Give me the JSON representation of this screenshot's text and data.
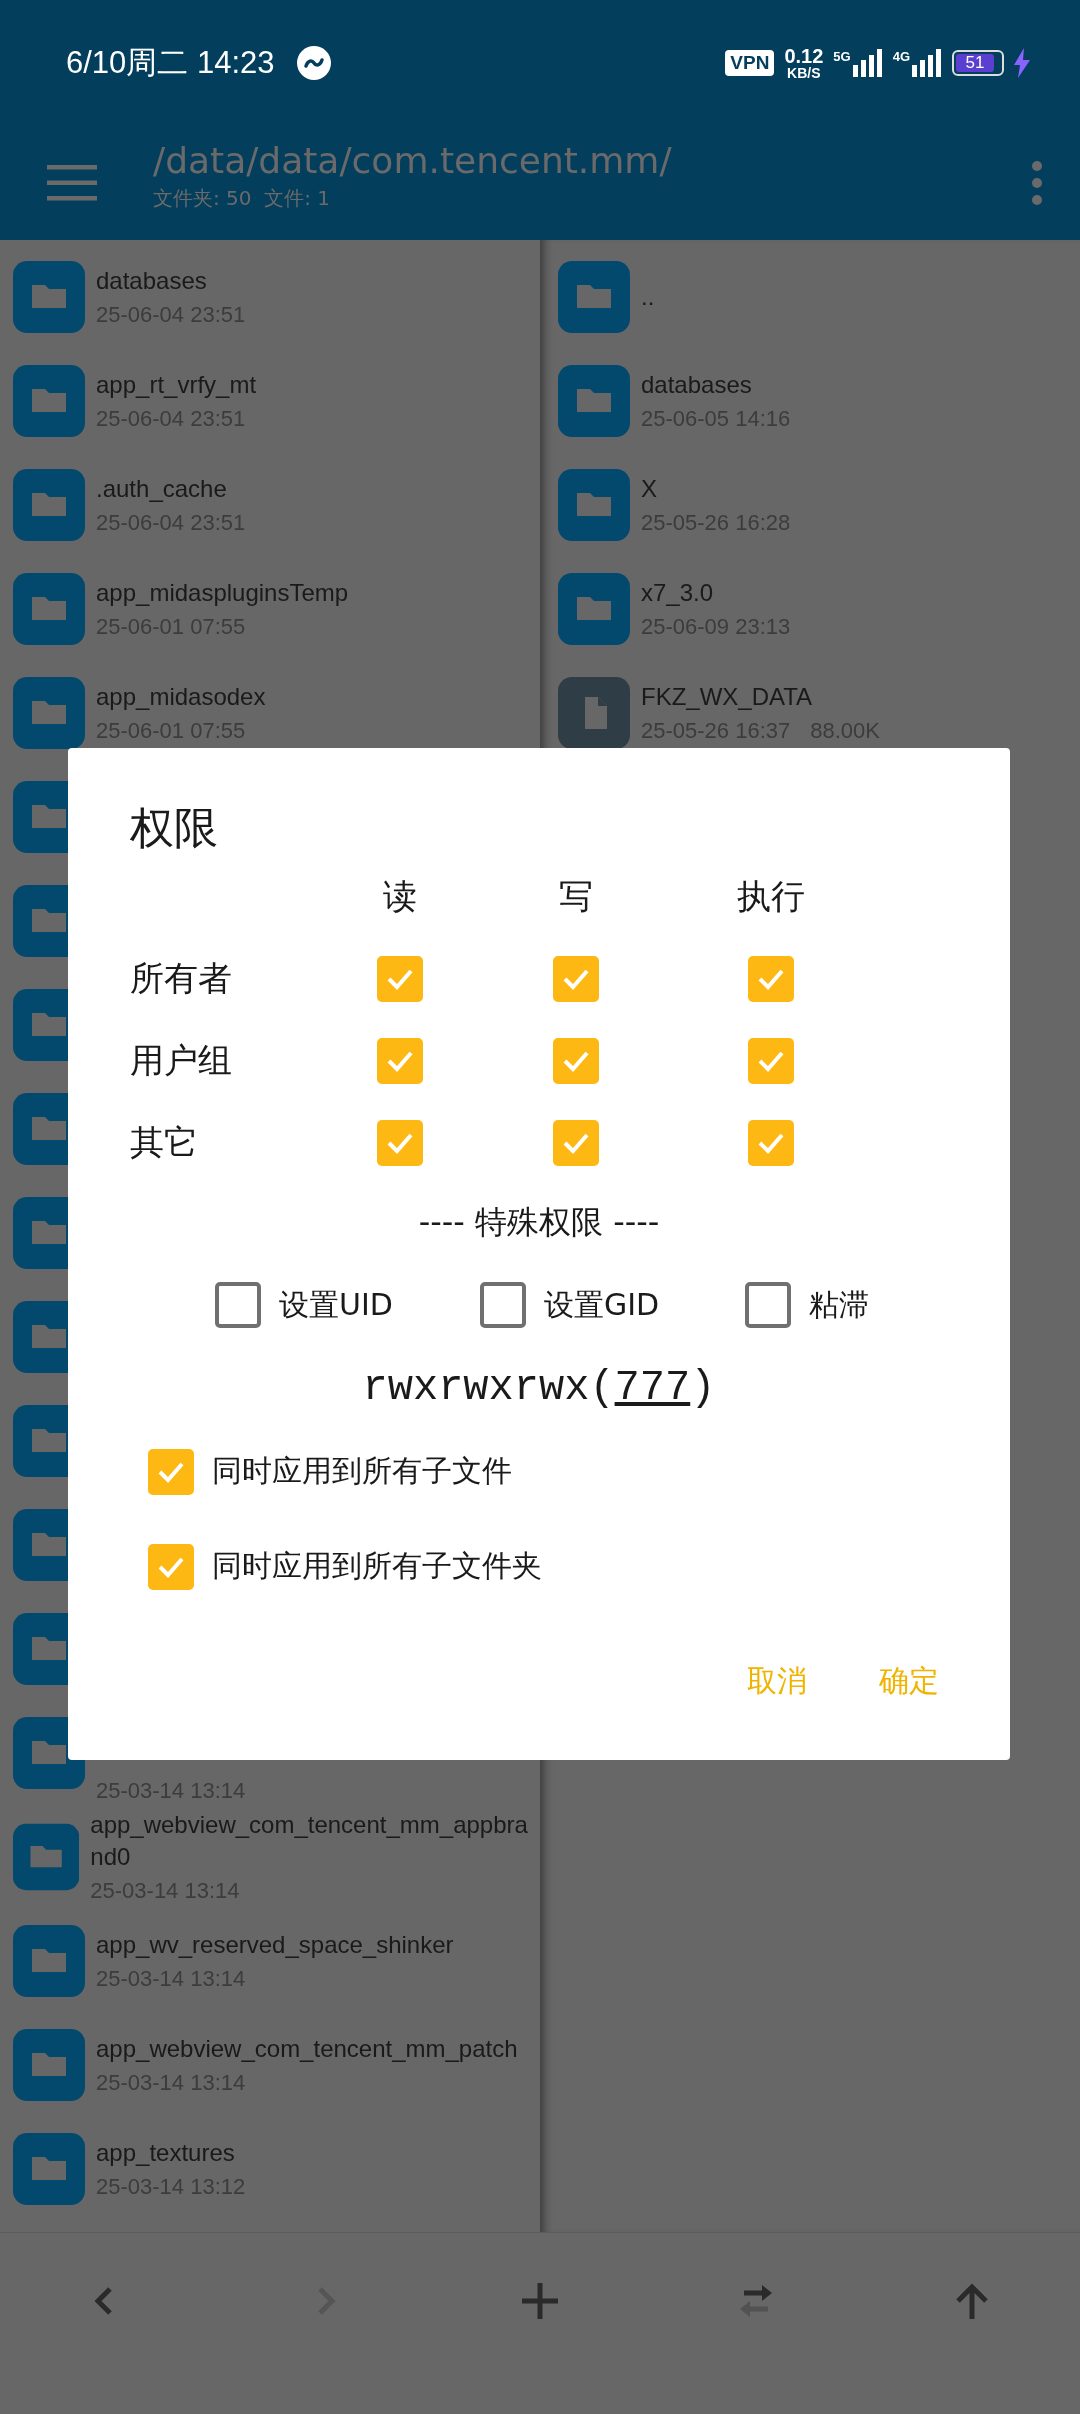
{
  "status_bar": {
    "time": "6/10周二 14:23",
    "vpn": "VPN",
    "speed_value": "0.12",
    "speed_unit": "KB/S",
    "network_1": "5G",
    "network_2": "4G",
    "battery": "51",
    "charging": true
  },
  "toolbar": {
    "path": "/data/data/com.tencent.mm/",
    "counts": "文件夹: 50  文件: 1"
  },
  "left_pane": {
    "items": [
      {
        "kind": "folder",
        "name": "databases",
        "date": "25-06-04 23:51"
      },
      {
        "kind": "folder",
        "name": "app_rt_vrfy_mt",
        "date": "25-06-04 23:51"
      },
      {
        "kind": "folder",
        "name": ".auth_cache",
        "date": "25-06-04 23:51"
      },
      {
        "kind": "folder",
        "name": "app_midaspluginsTemp",
        "date": "25-06-01 07:55"
      },
      {
        "kind": "folder",
        "name": "app_midasodex",
        "date": "25-06-01 07:55"
      },
      {
        "kind": "folder"
      },
      {
        "kind": "folder"
      },
      {
        "kind": "folder"
      },
      {
        "kind": "folder"
      },
      {
        "kind": "folder"
      },
      {
        "kind": "folder"
      },
      {
        "kind": "folder"
      },
      {
        "kind": "folder"
      },
      {
        "kind": "folder"
      },
      {
        "kind": "folder",
        "date": "25-03-14 13:14"
      },
      {
        "kind": "folder",
        "name": "app_webview_com_tencent_mm_appbrand0",
        "date": "25-03-14 13:14"
      },
      {
        "kind": "folder",
        "name": "app_wv_reserved_space_shinker",
        "date": "25-03-14 13:14"
      },
      {
        "kind": "folder",
        "name": "app_webview_com_tencent_mm_patch",
        "date": "25-03-14 13:14"
      },
      {
        "kind": "folder",
        "name": "app_textures",
        "date": "25-03-14 13:12"
      }
    ]
  },
  "right_pane": {
    "items": [
      {
        "kind": "folder",
        "name": ".."
      },
      {
        "kind": "folder",
        "name": "databases",
        "date": "25-06-05 14:16"
      },
      {
        "kind": "folder",
        "name": "X",
        "date": "25-05-26 16:28"
      },
      {
        "kind": "folder",
        "name": "x7_3.0",
        "date": "25-06-09 23:13"
      },
      {
        "kind": "file",
        "name": "FKZ_WX_DATA",
        "date": "25-05-26 16:37",
        "size": "88.00K"
      }
    ]
  },
  "dialog": {
    "title": "权限",
    "columns": [
      "读",
      "写",
      "执行"
    ],
    "rows": [
      {
        "label": "所有者",
        "checked": [
          true,
          true,
          true
        ]
      },
      {
        "label": "用户组",
        "checked": [
          true,
          true,
          true
        ]
      },
      {
        "label": "其它",
        "checked": [
          true,
          true,
          true
        ]
      }
    ],
    "special_title": "---- 特殊权限 ----",
    "special": [
      {
        "label": "设置UID",
        "checked": false
      },
      {
        "label": "设置GID",
        "checked": false
      },
      {
        "label": "粘滞",
        "checked": false
      }
    ],
    "mode": {
      "prefix": "rwxrwxrwx(",
      "octal": "777",
      "suffix": ")"
    },
    "options": [
      {
        "label": "同时应用到所有子文件",
        "checked": true
      },
      {
        "label": "同时应用到所有子文件夹",
        "checked": true
      }
    ],
    "buttons": [
      "取消",
      "确定"
    ]
  },
  "bottom_bar": {
    "buttons": [
      {
        "kind": "back",
        "disabled": false
      },
      {
        "kind": "forward",
        "disabled": true
      },
      {
        "kind": "add",
        "disabled": false
      },
      {
        "kind": "swap",
        "disabled": false
      },
      {
        "kind": "up",
        "disabled": false
      }
    ]
  }
}
